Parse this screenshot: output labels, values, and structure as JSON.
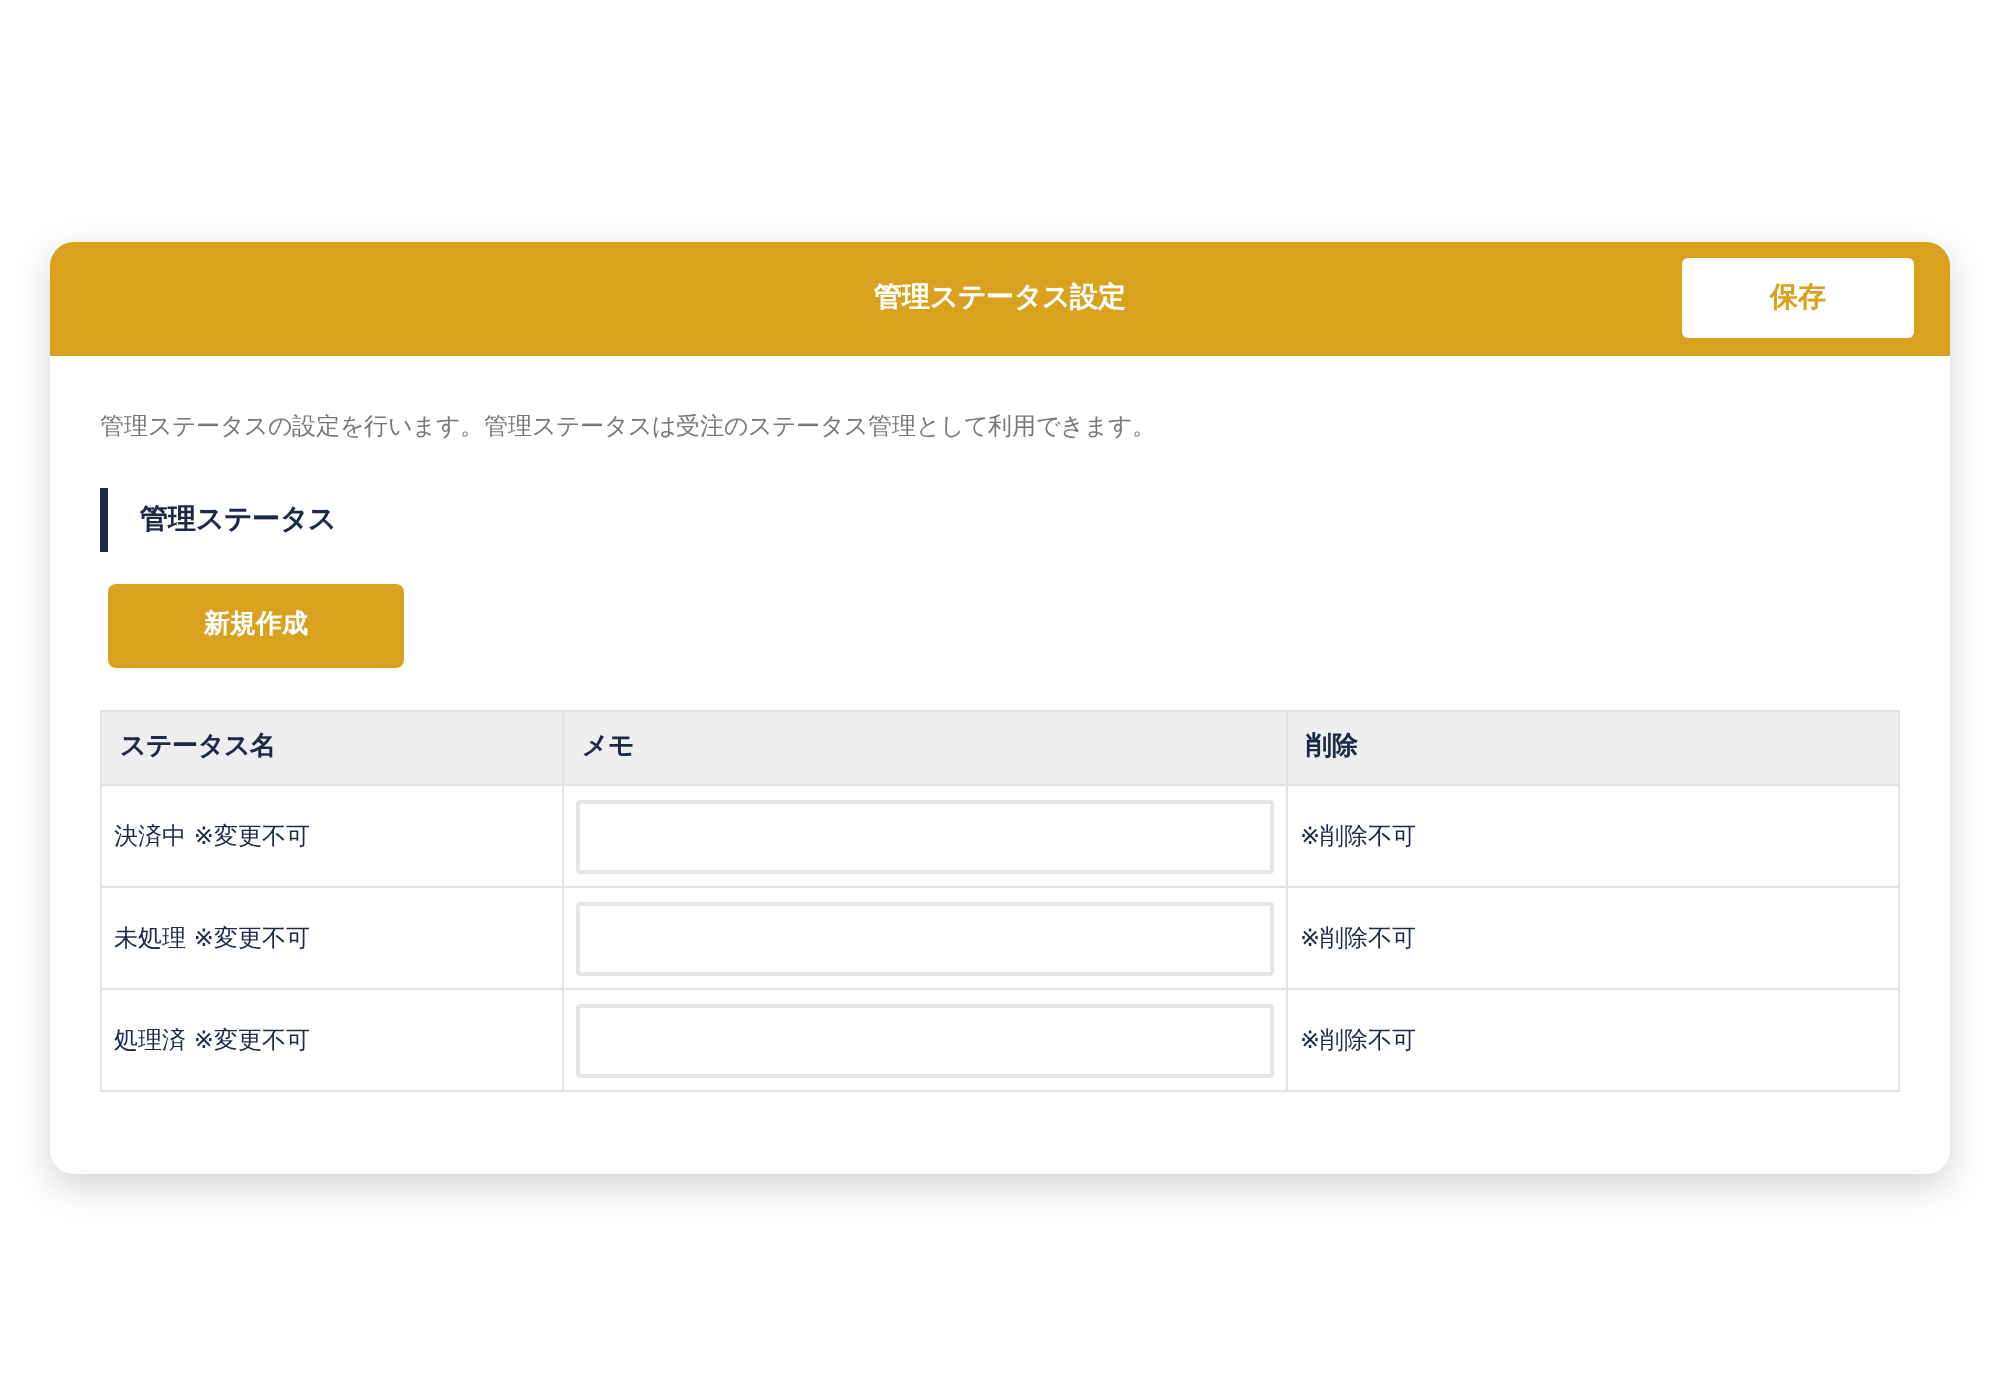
{
  "header": {
    "title": "管理ステータス設定",
    "save_button": "保存"
  },
  "description": "管理ステータスの設定を行います。管理ステータスは受注のステータス管理として利用できます。",
  "section": {
    "title": "管理ステータス"
  },
  "new_button": "新規作成",
  "table": {
    "columns": [
      "ステータス名",
      "メモ",
      "削除"
    ],
    "rows": [
      {
        "name": "決済中 ※変更不可",
        "delete": "※削除不可"
      },
      {
        "name": "未処理 ※変更不可",
        "delete": "※削除不可"
      },
      {
        "name": "処理済 ※変更不可",
        "delete": "※削除不可"
      }
    ]
  }
}
